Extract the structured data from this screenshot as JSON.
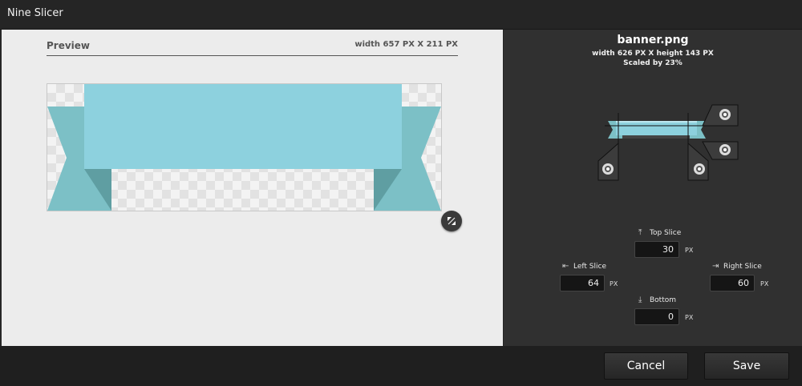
{
  "window": {
    "title": "Nine Slicer"
  },
  "preview": {
    "label": "Preview",
    "dimensions": "width 657 PX  X  211 PX"
  },
  "image": {
    "filename": "banner.png",
    "info": "width 626 PX   X   height 143 PX",
    "scaled": "Scaled by 23%"
  },
  "slices": {
    "top": {
      "label": "Top Slice",
      "value": "30",
      "unit": "PX",
      "icon": "arrow-up-bar-icon"
    },
    "left": {
      "label": "Left Slice",
      "value": "64",
      "unit": "PX",
      "icon": "arrow-left-bar-icon"
    },
    "right": {
      "label": "Right Slice",
      "value": "60",
      "unit": "PX",
      "icon": "arrow-right-bar-icon"
    },
    "bottom": {
      "label": "Bottom",
      "value": "0",
      "unit": "PX",
      "icon": "arrow-down-bar-icon"
    }
  },
  "buttons": {
    "cancel": "Cancel",
    "save": "Save"
  },
  "colors": {
    "banner": "#8dd1de",
    "ribbon_tail": "#7cc0c6",
    "ribbon_fold": "#5f9ea2"
  }
}
